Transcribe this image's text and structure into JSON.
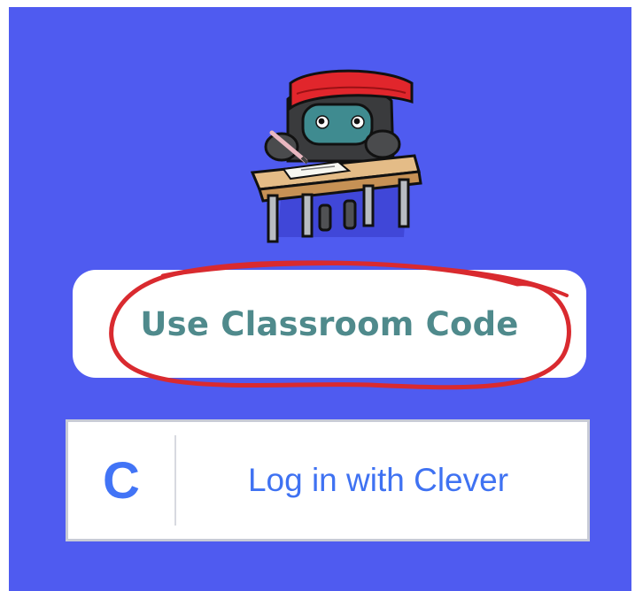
{
  "mascot": {
    "icon": "robot-student-at-desk-icon"
  },
  "buttons": {
    "classroom_code": "Use Classroom Code",
    "clever_logo": "C",
    "clever_login": "Log in with Clever"
  },
  "annotation": {
    "type": "hand-drawn-circle",
    "color": "#d92a2f"
  },
  "colors": {
    "background": "#4f5bf0",
    "classroom_text": "#4f8a8c",
    "clever_blue": "#3f72f2"
  }
}
